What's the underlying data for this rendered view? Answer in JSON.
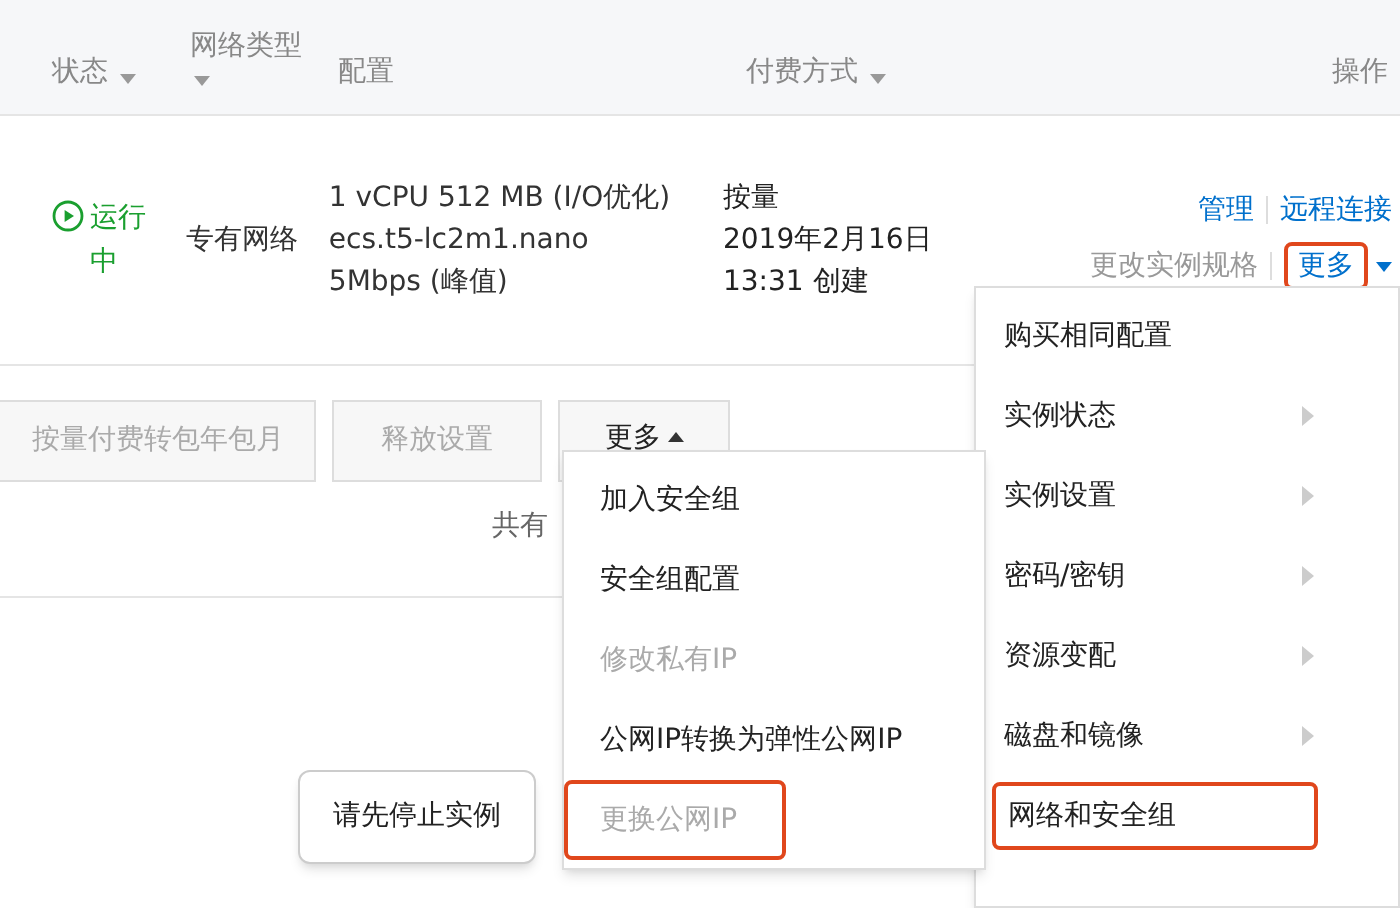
{
  "table": {
    "columns": [
      {
        "label": "状态",
        "sortable": true
      },
      {
        "label": "网络类型",
        "sortable": true
      },
      {
        "label": "配置",
        "sortable": false
      },
      {
        "label": "付费方式",
        "sortable": true
      },
      {
        "label": "操作",
        "sortable": false
      }
    ],
    "rows": [
      {
        "status": "运行中",
        "network": "专有网络",
        "config": [
          "1 vCPU 512 MB (I/O优化)",
          "ecs.t5-lc2m1.nano",
          "5Mbps (峰值)"
        ],
        "billing": [
          "按量",
          "2019年2月16日",
          "13:31 创建"
        ],
        "actions": [
          {
            "label": "管理",
            "disabled": false,
            "highlighted": false
          },
          {
            "label": "远程连接",
            "disabled": false,
            "highlighted": false
          },
          {
            "label": "更改实例规格",
            "disabled": true,
            "highlighted": false
          },
          {
            "label": "更多",
            "disabled": false,
            "highlighted": true
          }
        ]
      }
    ]
  },
  "bulk_buttons": [
    {
      "label": "按量付费转包年包月",
      "disabled": true
    },
    {
      "label": "释放设置",
      "disabled": true
    },
    {
      "label": "更多",
      "disabled": false
    }
  ],
  "footer_text": "共有",
  "more_menu": {
    "items": [
      {
        "label": "购买相同配置",
        "submenu": false,
        "highlighted": false
      },
      {
        "label": "实例状态",
        "submenu": true,
        "highlighted": false
      },
      {
        "label": "实例设置",
        "submenu": true,
        "highlighted": false
      },
      {
        "label": "密码/密钥",
        "submenu": true,
        "highlighted": false
      },
      {
        "label": "资源变配",
        "submenu": true,
        "highlighted": false
      },
      {
        "label": "磁盘和镜像",
        "submenu": true,
        "highlighted": false
      },
      {
        "label": "网络和安全组",
        "submenu": false,
        "highlighted": true
      }
    ]
  },
  "bulk_menu": {
    "items": [
      {
        "label": "加入安全组",
        "disabled": false,
        "highlighted": false
      },
      {
        "label": "安全组配置",
        "disabled": false,
        "highlighted": false
      },
      {
        "label": "修改私有IP",
        "disabled": true,
        "highlighted": false
      },
      {
        "label": "公网IP转换为弹性公网IP",
        "disabled": false,
        "highlighted": false
      },
      {
        "label": "更换公网IP",
        "disabled": true,
        "highlighted": true
      }
    ]
  },
  "tooltip": "请先停止实例"
}
